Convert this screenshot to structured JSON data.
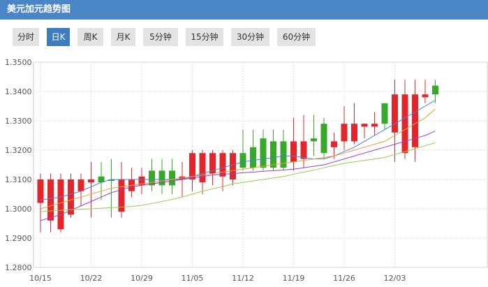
{
  "window": {
    "title": "美元加元趋势图"
  },
  "tabs": [
    {
      "label": "分时",
      "active": false
    },
    {
      "label": "日K",
      "active": true
    },
    {
      "label": "周K",
      "active": false
    },
    {
      "label": "月K",
      "active": false
    },
    {
      "label": "5分钟",
      "active": false
    },
    {
      "label": "15分钟",
      "active": false
    },
    {
      "label": "30分钟",
      "active": false
    },
    {
      "label": "60分钟",
      "active": false
    }
  ],
  "colors": {
    "title_bar": "#4a86c5",
    "tab_active": "#3d7cc3",
    "up": "#36a82a",
    "down": "#e3262c",
    "ma_blue": "#4a7fd6",
    "ma_orange": "#f09a3c",
    "ma_purple": "#9a3fd0",
    "ma_green": "#8fd14f"
  },
  "chart_data": {
    "type": "candlestick",
    "x_tick_labels": [
      "10/15",
      "10/22",
      "10/29",
      "11/05",
      "11/12",
      "11/19",
      "11/26",
      "12/03"
    ],
    "y_tick_labels": [
      "1.3500",
      "1.3400",
      "1.3300",
      "1.3200",
      "1.3100",
      "1.3000",
      "1.2900",
      "1.2800"
    ],
    "ylim": [
      1.28,
      1.35
    ],
    "grid": true,
    "candles": [
      {
        "o": 1.31,
        "h": 1.312,
        "l": 1.292,
        "c": 1.302
      },
      {
        "o": 1.31,
        "h": 1.312,
        "l": 1.292,
        "c": 1.296
      },
      {
        "o": 1.31,
        "h": 1.312,
        "l": 1.292,
        "c": 1.293
      },
      {
        "o": 1.31,
        "h": 1.312,
        "l": 1.297,
        "c": 1.298
      },
      {
        "o": 1.31,
        "h": 1.312,
        "l": 1.301,
        "c": 1.306
      },
      {
        "o": 1.31,
        "h": 1.316,
        "l": 1.297,
        "c": 1.309
      },
      {
        "o": 1.309,
        "h": 1.316,
        "l": 1.303,
        "c": 1.311
      },
      {
        "o": 1.31,
        "h": 1.317,
        "l": 1.297,
        "c": 1.31
      },
      {
        "o": 1.31,
        "h": 1.316,
        "l": 1.297,
        "c": 1.299
      },
      {
        "o": 1.31,
        "h": 1.314,
        "l": 1.304,
        "c": 1.306
      },
      {
        "o": 1.311,
        "h": 1.314,
        "l": 1.305,
        "c": 1.308
      },
      {
        "o": 1.308,
        "h": 1.317,
        "l": 1.306,
        "c": 1.313
      },
      {
        "o": 1.308,
        "h": 1.317,
        "l": 1.305,
        "c": 1.313
      },
      {
        "o": 1.308,
        "h": 1.317,
        "l": 1.305,
        "c": 1.313
      },
      {
        "o": 1.311,
        "h": 1.316,
        "l": 1.304,
        "c": 1.31
      },
      {
        "o": 1.319,
        "h": 1.32,
        "l": 1.306,
        "c": 1.31
      },
      {
        "o": 1.319,
        "h": 1.32,
        "l": 1.305,
        "c": 1.309
      },
      {
        "o": 1.319,
        "h": 1.32,
        "l": 1.308,
        "c": 1.312
      },
      {
        "o": 1.319,
        "h": 1.32,
        "l": 1.306,
        "c": 1.311
      },
      {
        "o": 1.319,
        "h": 1.32,
        "l": 1.308,
        "c": 1.31
      },
      {
        "o": 1.314,
        "h": 1.327,
        "l": 1.313,
        "c": 1.319
      },
      {
        "o": 1.314,
        "h": 1.327,
        "l": 1.313,
        "c": 1.321
      },
      {
        "o": 1.314,
        "h": 1.327,
        "l": 1.313,
        "c": 1.324
      },
      {
        "o": 1.314,
        "h": 1.327,
        "l": 1.313,
        "c": 1.323
      },
      {
        "o": 1.314,
        "h": 1.327,
        "l": 1.313,
        "c": 1.323
      },
      {
        "o": 1.323,
        "h": 1.331,
        "l": 1.313,
        "c": 1.316
      },
      {
        "o": 1.323,
        "h": 1.332,
        "l": 1.314,
        "c": 1.317
      },
      {
        "o": 1.323,
        "h": 1.332,
        "l": 1.318,
        "c": 1.324
      },
      {
        "o": 1.319,
        "h": 1.331,
        "l": 1.317,
        "c": 1.329
      },
      {
        "o": 1.323,
        "h": 1.326,
        "l": 1.317,
        "c": 1.321
      },
      {
        "o": 1.329,
        "h": 1.335,
        "l": 1.32,
        "c": 1.323
      },
      {
        "o": 1.329,
        "h": 1.336,
        "l": 1.322,
        "c": 1.323
      },
      {
        "o": 1.329,
        "h": 1.329,
        "l": 1.324,
        "c": 1.328
      },
      {
        "o": 1.329,
        "h": 1.333,
        "l": 1.325,
        "c": 1.328
      },
      {
        "o": 1.329,
        "h": 1.336,
        "l": 1.327,
        "c": 1.336
      },
      {
        "o": 1.339,
        "h": 1.344,
        "l": 1.316,
        "c": 1.326
      },
      {
        "o": 1.339,
        "h": 1.344,
        "l": 1.317,
        "c": 1.319
      },
      {
        "o": 1.339,
        "h": 1.344,
        "l": 1.316,
        "c": 1.321
      },
      {
        "o": 1.339,
        "h": 1.344,
        "l": 1.336,
        "c": 1.338
      },
      {
        "o": 1.339,
        "h": 1.344,
        "l": 1.336,
        "c": 1.342
      }
    ],
    "moving_averages": [
      {
        "color": "#4a7fd6",
        "values": [
          1.303,
          1.3035,
          1.304,
          1.305,
          1.306,
          1.3075,
          1.309,
          1.31,
          1.31,
          1.31,
          1.31,
          1.31,
          1.31,
          1.31,
          1.31,
          1.311,
          1.312,
          1.313,
          1.314,
          1.315,
          1.316,
          1.3165,
          1.317,
          1.3175,
          1.318,
          1.318,
          1.3175,
          1.317,
          1.317,
          1.318,
          1.3195,
          1.321,
          1.323,
          1.325,
          1.327,
          1.329,
          1.331,
          1.333,
          1.335,
          1.337
        ]
      },
      {
        "color": "#f09a3c",
        "values": [
          1.3,
          1.301,
          1.302,
          1.303,
          1.304,
          1.305,
          1.306,
          1.307,
          1.3075,
          1.308,
          1.3085,
          1.309,
          1.3095,
          1.31,
          1.3105,
          1.311,
          1.3115,
          1.312,
          1.3125,
          1.313,
          1.3135,
          1.314,
          1.3145,
          1.315,
          1.3155,
          1.316,
          1.3165,
          1.317,
          1.3175,
          1.318,
          1.319,
          1.32,
          1.321,
          1.322,
          1.323,
          1.325,
          1.327,
          1.329,
          1.331,
          1.334
        ]
      },
      {
        "color": "#9a3fd0",
        "values": [
          1.296,
          1.297,
          1.298,
          1.2995,
          1.301,
          1.3025,
          1.304,
          1.3055,
          1.3065,
          1.3075,
          1.308,
          1.3085,
          1.309,
          1.3095,
          1.31,
          1.3105,
          1.311,
          1.3115,
          1.3118,
          1.312,
          1.3123,
          1.3125,
          1.3128,
          1.313,
          1.3132,
          1.3135,
          1.314,
          1.3145,
          1.315,
          1.316,
          1.317,
          1.318,
          1.319,
          1.32,
          1.321,
          1.322,
          1.323,
          1.324,
          1.325,
          1.3265
        ]
      },
      {
        "color": "#8fd14f",
        "values": [
          1.299,
          1.2993,
          1.2995,
          1.2997,
          1.2998,
          1.3,
          1.3002,
          1.3004,
          1.3006,
          1.3008,
          1.3012,
          1.3018,
          1.3025,
          1.3032,
          1.304,
          1.305,
          1.306,
          1.3068,
          1.3076,
          1.3085,
          1.309,
          1.3095,
          1.31,
          1.3105,
          1.311,
          1.3118,
          1.3125,
          1.3132,
          1.314,
          1.3148,
          1.3155,
          1.316,
          1.3165,
          1.317,
          1.3175,
          1.3185,
          1.3195,
          1.3205,
          1.3215,
          1.3225
        ]
      }
    ]
  }
}
